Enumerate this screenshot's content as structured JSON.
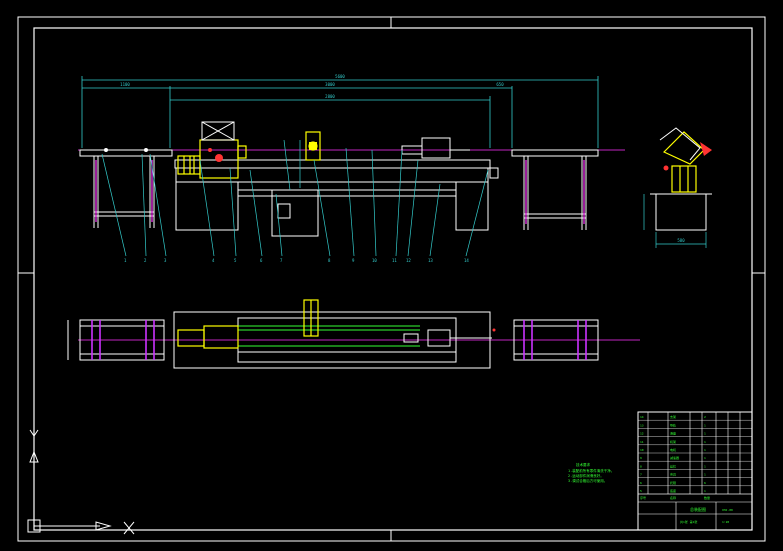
{
  "drawing": {
    "background": "#000000",
    "colors": {
      "frame": "#ffffff",
      "dimension": "#33cccc",
      "leader": "#33cccc",
      "centerline": "#ff33ff",
      "yellow": "#ffff00",
      "green": "#33ff33",
      "magenta": "#cc33ff",
      "red": "#ff3333"
    },
    "dimensions": {
      "overall": "5600",
      "left": "1100",
      "middle": "3000",
      "middle_inner": "2800",
      "right": "650",
      "end_width": "580"
    },
    "part_labels": [
      "1",
      "2",
      "3",
      "4",
      "5",
      "6",
      "7",
      "8",
      "9",
      "10",
      "11",
      "12",
      "13",
      "14"
    ],
    "notes_title": "技术要求",
    "notes_lines": [
      "1.装配前所有零件清洗干净。",
      "2.运动部件润滑良好。",
      "3.调试合格后方可使用。"
    ],
    "title_block": {
      "title": "总装配图",
      "drawing_no": "XHJ-00",
      "scale": "1:20",
      "sheet": "共1张 第1张",
      "bom_rows": [
        [
          "14",
          "支架",
          "2"
        ],
        [
          "13",
          "导轨",
          "1"
        ],
        [
          "12",
          "滑座",
          "1"
        ],
        [
          "11",
          "机架",
          "1"
        ],
        [
          "10",
          "电机",
          "1"
        ],
        [
          "9",
          "减速器",
          "1"
        ],
        [
          "8",
          "丝杠",
          "1"
        ],
        [
          "7",
          "夹具",
          "1"
        ],
        [
          "6",
          "托辊",
          "6"
        ],
        [
          "5",
          "底座",
          "1"
        ]
      ],
      "header": [
        "序号",
        "名称",
        "数量"
      ]
    },
    "ucs": {
      "x_label": "X",
      "y_label": "Y"
    }
  }
}
